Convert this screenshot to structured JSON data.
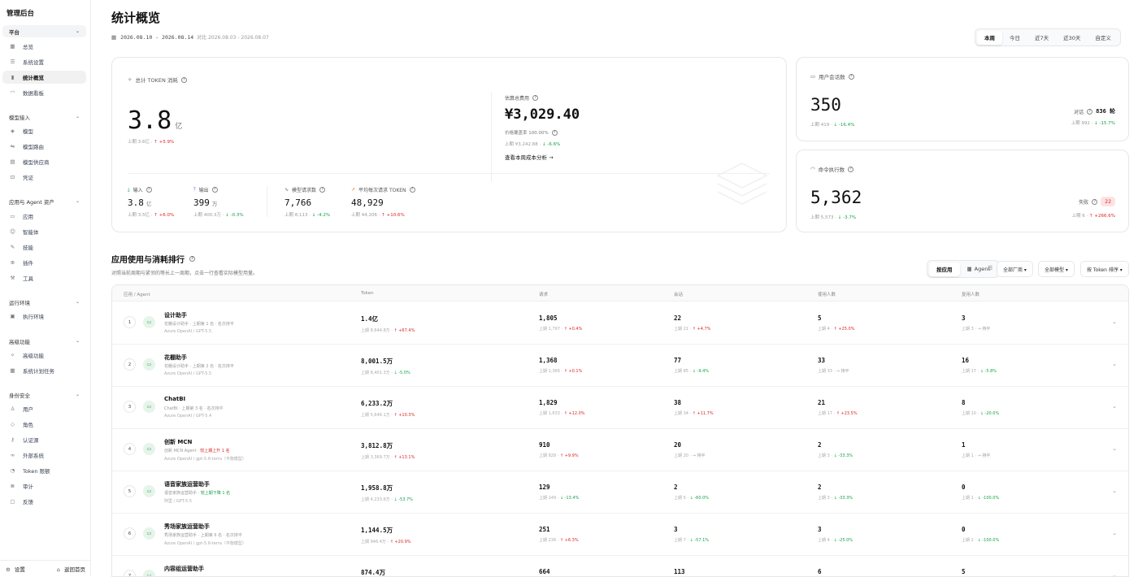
{
  "sidebar": {
    "title": "管理后台",
    "groups": [
      {
        "label": "平台",
        "items": [
          {
            "label": "总览",
            "icon": "grid-icon"
          },
          {
            "label": "系统设置",
            "icon": "sliders-icon"
          },
          {
            "label": "统计概览",
            "icon": "bar-chart-icon",
            "active": true
          },
          {
            "label": "数据看板",
            "icon": "gauge-icon"
          }
        ]
      },
      {
        "label": "模型接入",
        "items": [
          {
            "label": "模型",
            "icon": "cube-icon"
          },
          {
            "label": "模型路由",
            "icon": "route-icon"
          },
          {
            "label": "模型供应商",
            "icon": "server-icon"
          },
          {
            "label": "凭证",
            "icon": "lock-icon"
          }
        ]
      },
      {
        "label": "应用与 Agent 资产",
        "items": [
          {
            "label": "应用",
            "icon": "window-icon"
          },
          {
            "label": "智能体",
            "icon": "bot-icon"
          },
          {
            "label": "技能",
            "icon": "wrench-icon"
          },
          {
            "label": "插件",
            "icon": "plug-icon"
          },
          {
            "label": "工具",
            "icon": "hammer-icon"
          }
        ]
      },
      {
        "label": "运行环境",
        "items": [
          {
            "label": "执行环境",
            "icon": "terminal-icon"
          }
        ]
      },
      {
        "label": "高级功能",
        "items": [
          {
            "label": "高级功能",
            "icon": "sparkle-icon"
          },
          {
            "label": "系统计划任务",
            "icon": "calendar-icon"
          }
        ]
      },
      {
        "label": "身份安全",
        "items": [
          {
            "label": "用户",
            "icon": "user-icon"
          },
          {
            "label": "角色",
            "icon": "shield-icon"
          },
          {
            "label": "认证源",
            "icon": "key-icon"
          },
          {
            "label": "外部系统",
            "icon": "link-icon"
          },
          {
            "label": "Token 限额",
            "icon": "meter-icon"
          },
          {
            "label": "审计",
            "icon": "audit-icon"
          },
          {
            "label": "反馈",
            "icon": "message-icon"
          }
        ]
      }
    ],
    "settings_label": "设置",
    "home_label": "返回首页"
  },
  "header": {
    "title": "统计概览",
    "date_range": "2026.08.10 - 2026.08.14",
    "compare": "对比 2026.08.03 - 2026.08.07",
    "range_options": [
      "本周",
      "今日",
      "近7天",
      "近30天",
      "自定义"
    ],
    "range_selected": "本周"
  },
  "token_card": {
    "title": "总计 TOKEN 消耗",
    "total_value": "3.8",
    "total_unit": "亿",
    "total_prev": "上期 3.6亿",
    "total_delta": "+5.9%",
    "cost_label": "估算总费用",
    "cost_value": "¥3,029.40",
    "coverage_label": "价格覆盖率 100.00%",
    "cost_prev": "上期 ¥3,242.88",
    "cost_delta": "-6.6%",
    "cost_link": "查看本周成本分析 →",
    "metrics": [
      {
        "label": "输入",
        "value": "3.8",
        "unit": "亿",
        "prev": "上期 3.5亿",
        "delta": "+6.0%",
        "dir": "up",
        "icon": "download-icon"
      },
      {
        "label": "输出",
        "value": "399",
        "unit": "万",
        "prev": "上期 400.3万",
        "delta": "-0.3%",
        "dir": "down",
        "icon": "upload-icon"
      },
      {
        "label": "模型请求数",
        "value": "7,766",
        "unit": "",
        "prev": "上期 8,113",
        "delta": "-4.2%",
        "dir": "down",
        "icon": "activity-icon"
      },
      {
        "label": "平均每次请求 TOKEN",
        "value": "48,929",
        "unit": "",
        "prev": "上期 44,206",
        "delta": "+10.6%",
        "dir": "up",
        "icon": "trend-icon"
      }
    ]
  },
  "session_card": {
    "title": "用户会话数",
    "value": "350",
    "prev": "上期 419",
    "delta": "-16.4%",
    "side_label": "对话",
    "side_value": "836 轮",
    "side_prev": "上期 992",
    "side_delta": "-15.7%"
  },
  "command_card": {
    "title": "命令执行数",
    "value": "5,362",
    "prev": "上期 5,573",
    "delta": "-3.7%",
    "side_label": "失败",
    "side_value": "22",
    "side_prev": "上期 6",
    "side_delta": "+266.6%"
  },
  "ranking": {
    "title": "应用使用与消耗排行",
    "desc": "对照当前周期与紧邻的等长上一周期，点击一行查看实际模型用量。",
    "view_options": [
      "按应用",
      "Agent"
    ],
    "filters": [
      "全部厂商 ▾",
      "全部模型 ▾",
      "按 Token 排序 ▾"
    ],
    "columns": [
      "应用 / Agent",
      "Token",
      "请求",
      "会话",
      "使用人数",
      "复用人数"
    ],
    "rows": [
      {
        "rank": "1",
        "name": "设计助手",
        "sub": "花棚设计助手 · 上期第 1 名 · 名次持平",
        "sub_hl": "",
        "provider": "Azure OpenAI / GPT-5.5",
        "token": "1.4亿",
        "token_prev": "上期 8,644.8万",
        "token_delta": "↑ +67.4%",
        "token_dir": "up",
        "req": "1,805",
        "req_prev": "上期 1,797",
        "req_delta": "↑ +0.4%",
        "req_dir": "up",
        "sess": "22",
        "sess_prev": "上期 21",
        "sess_delta": "↑ +4.7%",
        "sess_dir": "up",
        "users": "5",
        "users_prev": "上期 4",
        "users_delta": "↑ +25.0%",
        "users_dir": "up",
        "reuse": "3",
        "reuse_prev": "上期 3",
        "reuse_delta": "→ 持平",
        "reuse_dir": "flat"
      },
      {
        "rank": "2",
        "name": "花棚助手",
        "sub": "花棚设计助手 · 上期第 2 名 · 名次持平",
        "sub_hl": "",
        "provider": "Azure OpenAI / GPT-5.5",
        "token": "8,001.5万",
        "token_prev": "上期 8,401.3万",
        "token_delta": "↓ -5.0%",
        "token_dir": "down",
        "req": "1,368",
        "req_prev": "上期 1,366",
        "req_delta": "↑ +0.1%",
        "req_dir": "up",
        "sess": "77",
        "sess_prev": "上期 85",
        "sess_delta": "↓ -9.4%",
        "sess_dir": "down",
        "users": "33",
        "users_prev": "上期 33",
        "users_delta": "→ 持平",
        "users_dir": "flat",
        "reuse": "16",
        "reuse_prev": "上期 17",
        "reuse_delta": "↓ -5.8%",
        "reuse_dir": "down"
      },
      {
        "rank": "3",
        "name": "ChatBI",
        "sub": "ChatBI · 上期第 3 名 · 名次持平",
        "sub_hl": "",
        "provider": "Azure OpenAI / GPT-5.4",
        "token": "6,233.2万",
        "token_prev": "上期 5,646.1万",
        "token_delta": "↑ +10.3%",
        "token_dir": "up",
        "req": "1,829",
        "req_prev": "上期 1,633",
        "req_delta": "↑ +12.0%",
        "req_dir": "up",
        "sess": "38",
        "sess_prev": "上期 34",
        "sess_delta": "↑ +11.7%",
        "sess_dir": "up",
        "users": "21",
        "users_prev": "上期 17",
        "users_delta": "↑ +23.5%",
        "users_dir": "up",
        "reuse": "8",
        "reuse_prev": "上期 10",
        "reuse_delta": "↓ -20.0%",
        "reuse_dir": "down"
      },
      {
        "rank": "4",
        "name": "创新 MCN",
        "sub": "创新 MCN Agent · ",
        "sub_hl": "较上期上升 1 名",
        "sub_hl_dir": "up",
        "provider": "Azure OpenAI / gpt-5.6-terra（平衡模型）",
        "token": "3,812.8万",
        "token_prev": "上期 3,369.7万",
        "token_delta": "↑ +13.1%",
        "token_dir": "up",
        "req": "910",
        "req_prev": "上期 828",
        "req_delta": "↑ +9.9%",
        "req_dir": "up",
        "sess": "20",
        "sess_prev": "上期 20",
        "sess_delta": "→ 持平",
        "sess_dir": "flat",
        "users": "2",
        "users_prev": "上期 3",
        "users_delta": "↓ -33.3%",
        "users_dir": "down",
        "reuse": "1",
        "reuse_prev": "上期 1",
        "reuse_delta": "→ 持平",
        "reuse_dir": "flat"
      },
      {
        "rank": "5",
        "name": "语音家族运营助手",
        "sub": "语音家族运营助手 · ",
        "sub_hl": "较上期下降 1 名",
        "sub_hl_dir": "down",
        "provider": "阿里 / GPT-5.5",
        "token": "1,958.8万",
        "token_prev": "上期 4,233.6万",
        "token_delta": "↓ -53.7%",
        "token_dir": "down",
        "req": "129",
        "req_prev": "上期 149",
        "req_delta": "↓ -13.4%",
        "req_dir": "down",
        "sess": "2",
        "sess_prev": "上期 5",
        "sess_delta": "↓ -60.0%",
        "sess_dir": "down",
        "users": "2",
        "users_prev": "上期 3",
        "users_delta": "↓ -33.3%",
        "users_dir": "down",
        "reuse": "0",
        "reuse_prev": "上期 1",
        "reuse_delta": "↓ -100.0%",
        "reuse_dir": "down"
      },
      {
        "rank": "6",
        "name": "秀场家族运营助手",
        "sub": "秀场家族运营助手 · 上期第 6 名 · 名次持平",
        "sub_hl": "",
        "provider": "Azure OpenAI / gpt-5.6-terra（平衡模型）",
        "token": "1,144.5万",
        "token_prev": "上期 946.4万",
        "token_delta": "↑ +20.9%",
        "token_dir": "up",
        "req": "251",
        "req_prev": "上期 236",
        "req_delta": "↑ +6.3%",
        "req_dir": "up",
        "sess": "3",
        "sess_prev": "上期 7",
        "sess_delta": "↓ -57.1%",
        "sess_dir": "down",
        "users": "3",
        "users_prev": "上期 4",
        "users_delta": "↓ -25.0%",
        "users_dir": "down",
        "reuse": "0",
        "reuse_prev": "上期 2",
        "reuse_delta": "↓ -100.0%",
        "reuse_dir": "down"
      },
      {
        "rank": "7",
        "name": "内容组运营助手",
        "sub": "",
        "sub_hl": "",
        "provider": "",
        "token": "874.4万",
        "token_prev": "",
        "token_delta": "",
        "token_dir": "flat",
        "req": "664",
        "req_prev": "",
        "req_delta": "",
        "req_dir": "flat",
        "sess": "113",
        "sess_prev": "",
        "sess_delta": "",
        "sess_dir": "flat",
        "users": "6",
        "users_prev": "",
        "users_delta": "",
        "users_dir": "flat",
        "reuse": "5",
        "reuse_prev": "",
        "reuse_delta": "",
        "reuse_dir": "flat"
      }
    ]
  }
}
